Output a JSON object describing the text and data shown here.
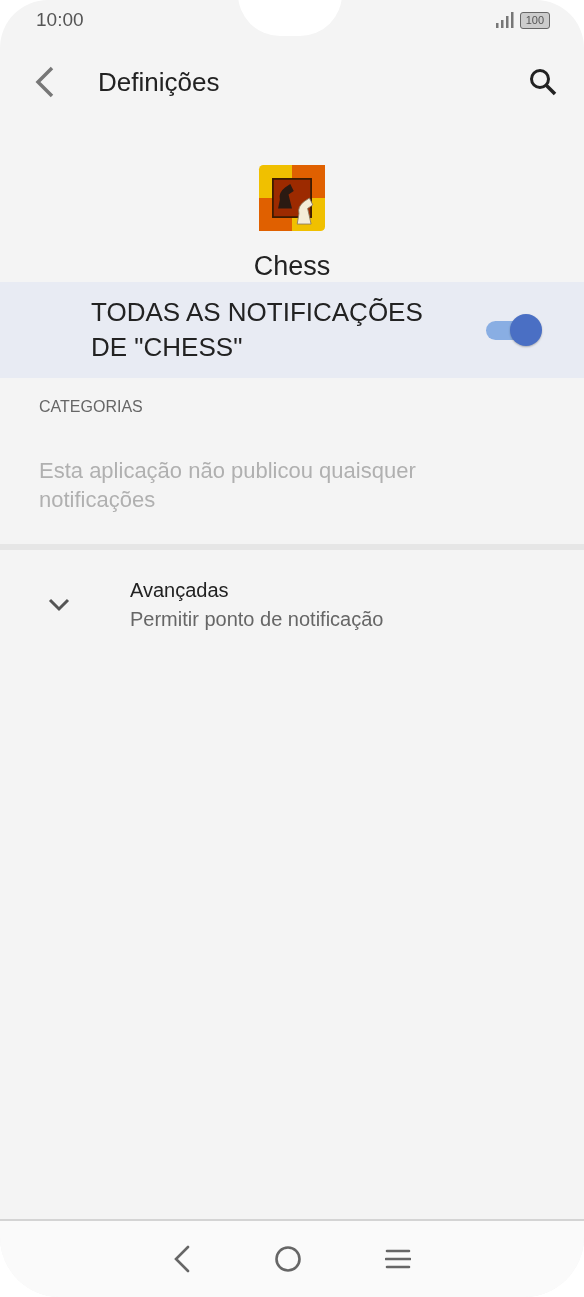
{
  "status_bar": {
    "time": "10:00",
    "battery": "100"
  },
  "app_bar": {
    "title": "Definições"
  },
  "app": {
    "name": "Chess"
  },
  "master_toggle": {
    "label": "TODAS AS NOTIFICAÇÕES DE \"CHESS\"",
    "on": true
  },
  "categories": {
    "title": "CATEGORIAS",
    "empty_text": "Esta aplicação não publicou quaisquer notificações"
  },
  "advanced": {
    "title": "Avançadas",
    "subtitle": "Permitir ponto de notificação",
    "expanded": false
  }
}
